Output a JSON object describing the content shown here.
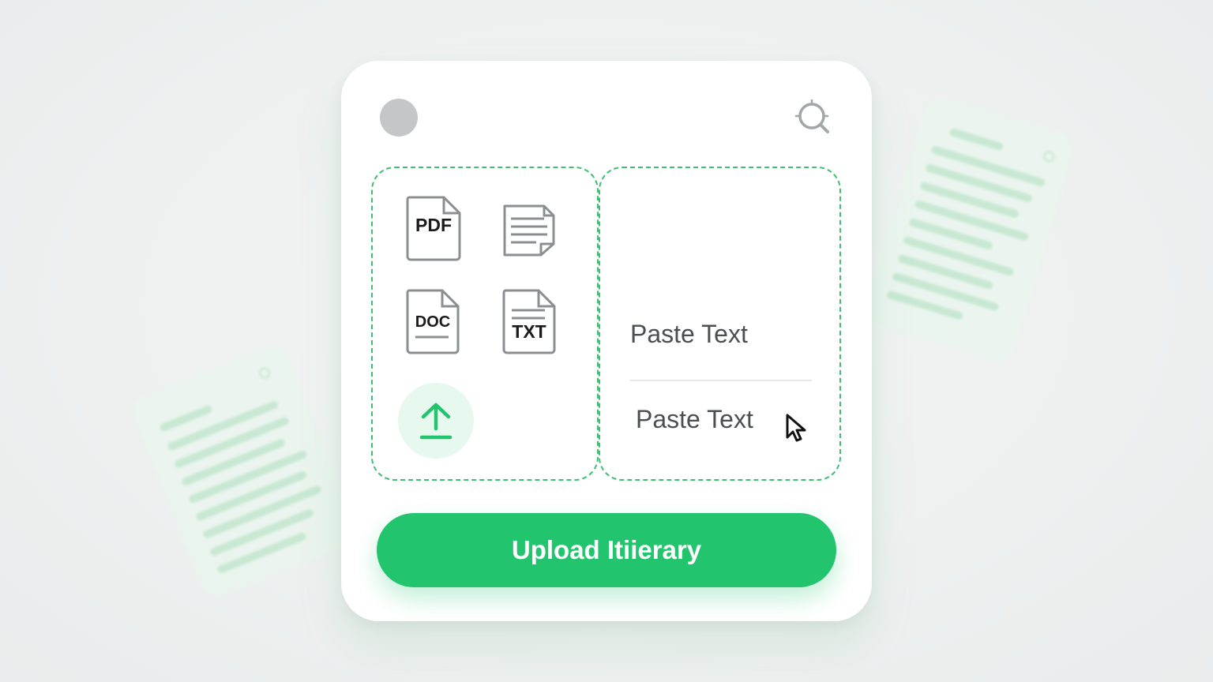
{
  "colors": {
    "accent": "#22c56e",
    "dashed_border": "#3fbf72",
    "upload_circle_bg": "#e7f8ee",
    "avatar": "#c4c6c8",
    "icon_stroke": "#8c8f92"
  },
  "header": {
    "avatar_icon": "avatar-circle",
    "search_icon": "search-icon"
  },
  "upload_zone": {
    "file_types": [
      {
        "icon": "pdf-file-icon",
        "label": "PDF"
      },
      {
        "icon": "text-document-icon",
        "label": ""
      },
      {
        "icon": "doc-file-icon",
        "label": "DOC"
      },
      {
        "icon": "txt-file-icon",
        "label": "TXT"
      }
    ],
    "upload_icon": "upload-arrow-icon"
  },
  "paste_zone": {
    "label_top": "Paste Text",
    "label_bottom": "Paste Text",
    "cursor_icon": "mouse-cursor-icon"
  },
  "primary_button": {
    "label": "Upload Itiierary"
  }
}
